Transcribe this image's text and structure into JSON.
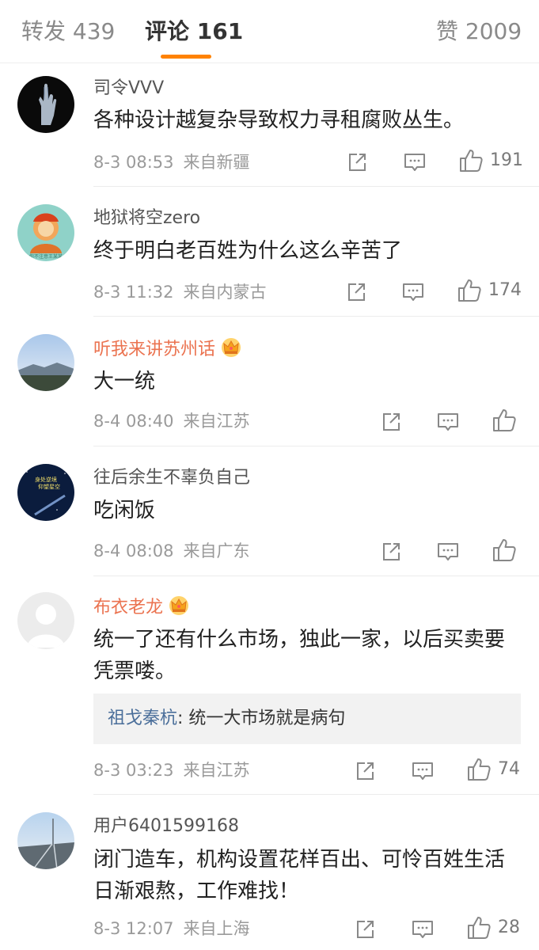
{
  "tabs": {
    "repost": "转发 439",
    "comments": "评论 161",
    "likes": "赞 2009"
  },
  "comments": [
    {
      "username": "司令VVV",
      "text": "各种设计越复杂导致权力寻租腐败丛生。",
      "time": "8-3 08:53",
      "location": "来自新疆",
      "like_count": "191"
    },
    {
      "username": "地狱将空zero",
      "text": "终于明白老百姓为什么这么辛苦了",
      "time": "8-3 11:32",
      "location": "来自内蒙古",
      "like_count": "174"
    },
    {
      "username": "听我来讲苏州话",
      "text": "大一统",
      "time": "8-4 08:40",
      "location": "来自江苏",
      "like_count": ""
    },
    {
      "username": "往后余生不辜负自己",
      "text": "吃闲饭",
      "time": "8-4 08:08",
      "location": "来自广东",
      "like_count": ""
    },
    {
      "username": "布衣老龙",
      "text": "统一了还有什么市场，独此一家，以后买卖要凭票喽。",
      "reply_user": "祖戈秦杭",
      "reply_text": ": 统一大市场就是病句",
      "time": "8-3 03:23",
      "location": "来自江苏",
      "like_count": "74"
    },
    {
      "username": "用户6401599168",
      "text": "闭门造车，机构设置花样百出、可怜百姓生活日渐艰熬，工作难找！",
      "time": "8-3 12:07",
      "location": "来自上海",
      "like_count": "28"
    }
  ],
  "avatar_badge_text": {
    "avatar_4_line1": "身处逆境",
    "avatar_4_line2": "仰望星空",
    "avatar_2_caption": "你不注意王某某"
  },
  "colors": {
    "accent": "#ff8200",
    "vip_name": "#eb7350",
    "reply_link": "#4a6e9a"
  },
  "icons": {
    "share": "share-icon",
    "comment": "comment-icon",
    "like": "like-icon",
    "vip": "crown-icon"
  }
}
